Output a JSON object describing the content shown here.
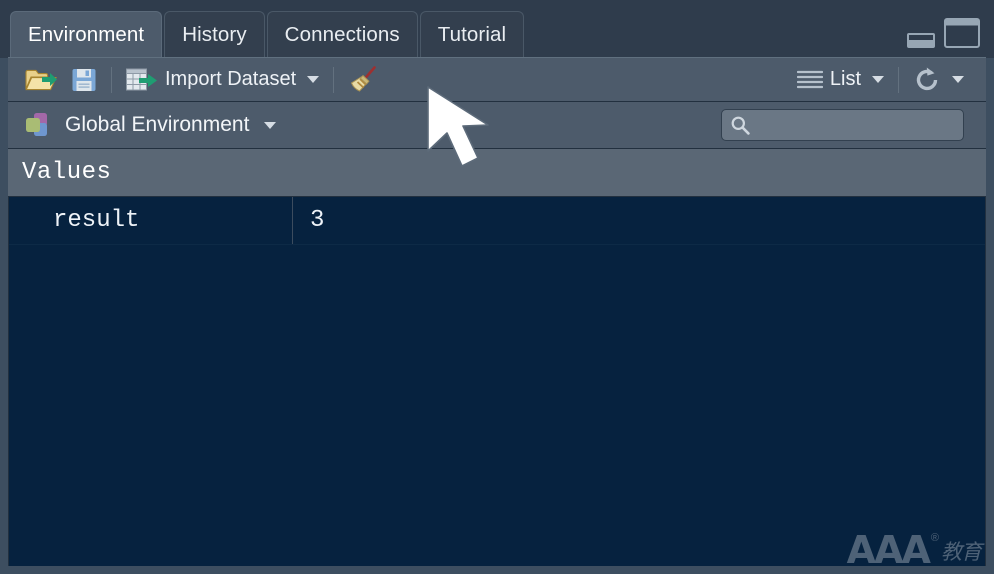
{
  "window": {
    "minimize_label": "minimize",
    "maximize_label": "maximize"
  },
  "tabs": [
    {
      "label": "Environment",
      "active": true
    },
    {
      "label": "History",
      "active": false
    },
    {
      "label": "Connections",
      "active": false
    },
    {
      "label": "Tutorial",
      "active": false
    }
  ],
  "toolbar": {
    "load_workspace_label": "",
    "save_workspace_label": "",
    "import_dataset_label": "Import Dataset",
    "clear_label": "",
    "view_mode_label": "List",
    "refresh_label": "",
    "icons": {
      "load": "open-folder-icon",
      "save": "floppy-save-icon",
      "import": "table-import-icon",
      "clear": "broom-icon",
      "list": "list-lines-icon",
      "refresh": "refresh-icon"
    }
  },
  "environment": {
    "selector_label": "Global Environment",
    "selector_icon": "environment-cubes-icon"
  },
  "search": {
    "value": "",
    "placeholder": "",
    "icon": "search-icon"
  },
  "groups": [
    {
      "title": "Values",
      "rows": [
        {
          "name": "result",
          "value": "3"
        }
      ]
    }
  ],
  "watermark": {
    "brand": "AAA",
    "registered": "®",
    "subtitle": "教育"
  },
  "colors": {
    "frame": "#3d4e60",
    "tabbar": "#2f3c4c",
    "tab_active": "#4d5b6b",
    "tab_inactive": "#333f4e",
    "toolbar": "#4d5b6b",
    "group_header": "#5a6775",
    "list_background": "#06223f",
    "text": "#ffffff",
    "accent_green": "#1f9d72",
    "accent_blue": "#7ba7d6"
  }
}
